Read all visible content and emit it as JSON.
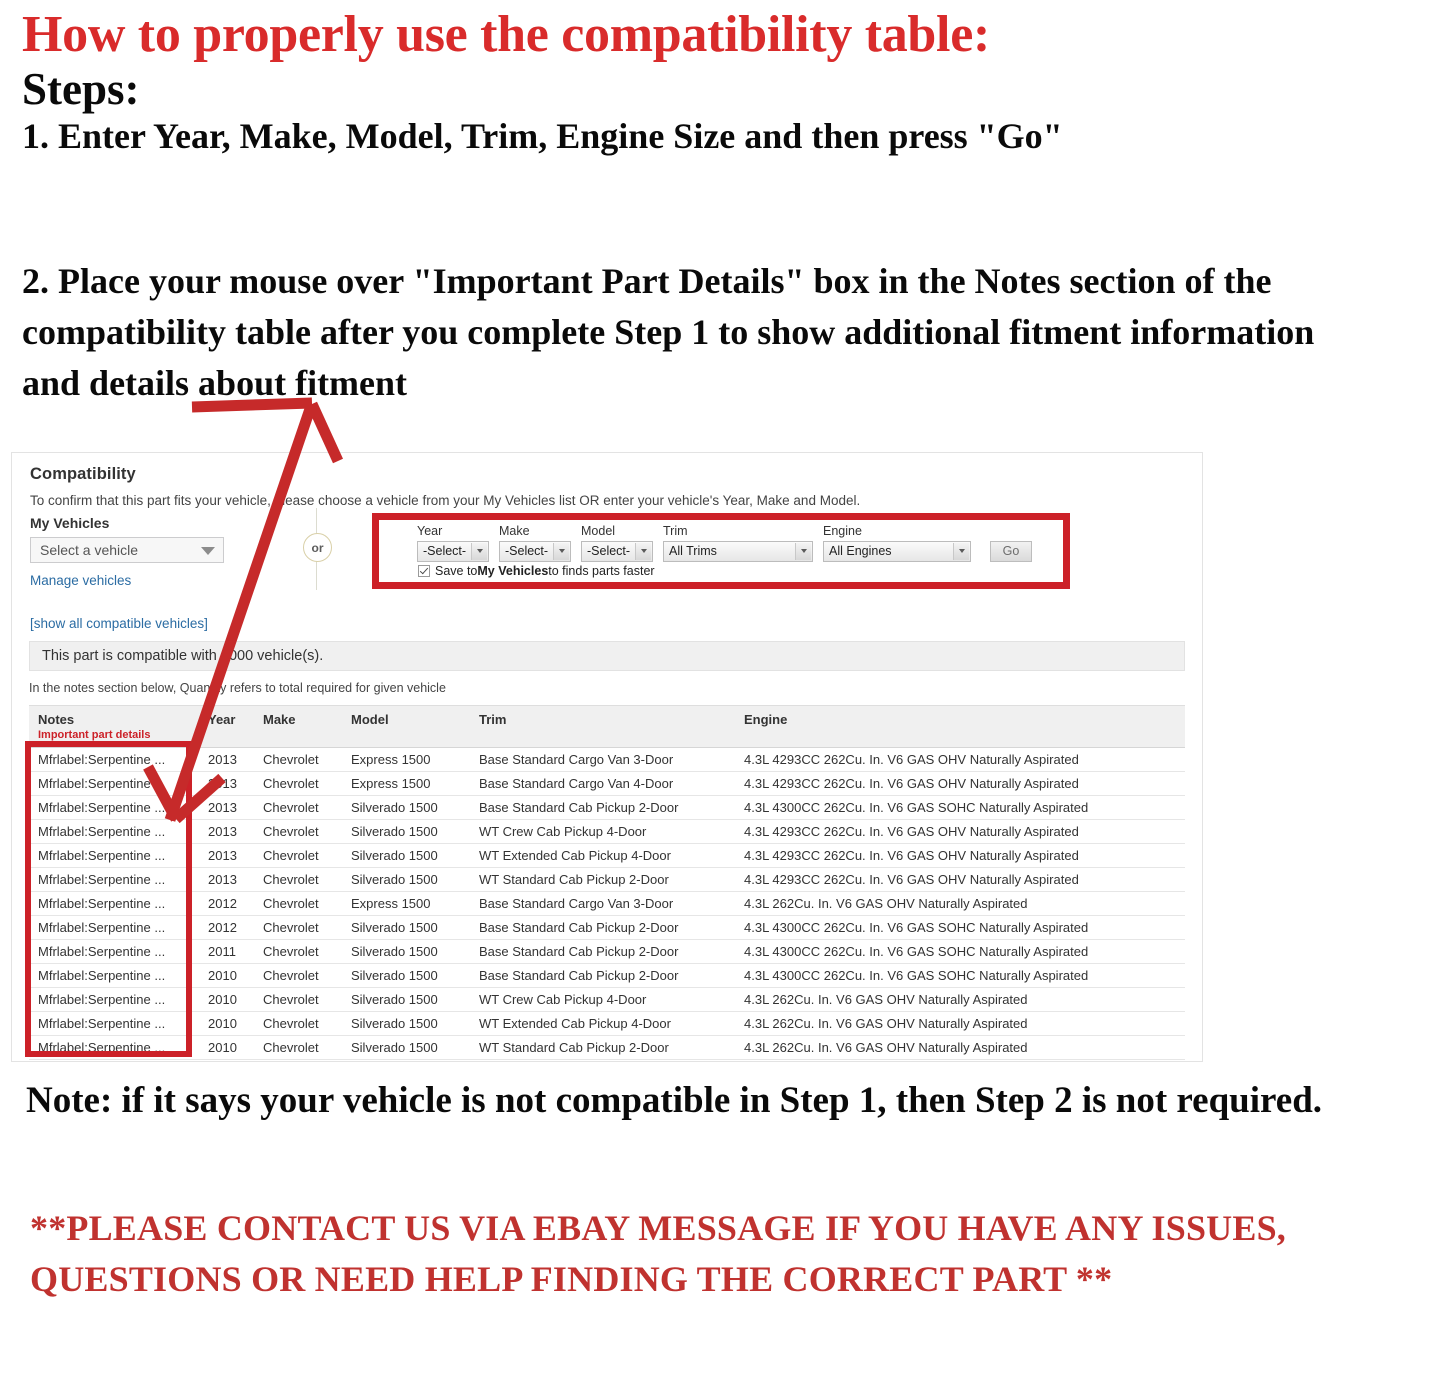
{
  "instructions": {
    "title": "How to properly use the compatibility table:",
    "steps_label": "Steps:",
    "step1": "1. Enter Year, Make, Model, Trim, Engine Size and then press \"Go\"",
    "step2": "2. Place your mouse over \"Important Part Details\" box in the Notes section of the compatibility table after you complete Step 1 to show additional fitment information and details about fitment",
    "bottom_note": "Note: if it says your vehicle is not compatible in Step 1, then Step 2 is not required.",
    "contact_note": "**PLEASE CONTACT US VIA EBAY MESSAGE IF YOU HAVE ANY ISSUES, QUESTIONS OR NEED HELP FINDING THE CORRECT PART **"
  },
  "compatibility": {
    "heading": "Compatibility",
    "description": "To confirm that this part fits your vehicle, please choose a vehicle from your My Vehicles list OR enter your vehicle's Year, Make and Model.",
    "my_vehicles": {
      "label": "My Vehicles",
      "select_value": "Select a vehicle",
      "manage_link": "Manage vehicles",
      "show_all_link": "[show all compatible vehicles]"
    },
    "or_divider": "or",
    "form": {
      "year": {
        "label": "Year",
        "value": "-Select-"
      },
      "make": {
        "label": "Make",
        "value": "-Select-"
      },
      "model": {
        "label": "Model",
        "value": "-Select-"
      },
      "trim": {
        "label": "Trim",
        "value": "All Trims"
      },
      "engine": {
        "label": "Engine",
        "value": "All Engines"
      },
      "go_button": "Go",
      "save_text_before": "Save to ",
      "save_text_bold": "My Vehicles",
      "save_text_after": " to finds parts faster",
      "highlight_color": "#cc2128"
    },
    "result_bar": "This part is compatible with 1000 vehicle(s).",
    "notes_hint": "In the notes section below, Quantity refers to total required for given vehicle",
    "table": {
      "headers": {
        "notes": "Notes",
        "notes_sub": "Important part details",
        "year": "Year",
        "make": "Make",
        "model": "Model",
        "trim": "Trim",
        "engine": "Engine"
      },
      "rows": [
        {
          "notes": "Mfrlabel:Serpentine ...",
          "year": "2013",
          "make": "Chevrolet",
          "model": "Express 1500",
          "trim": "Base Standard Cargo Van 3-Door",
          "engine": "4.3L 4293CC 262Cu. In. V6 GAS OHV Naturally Aspirated"
        },
        {
          "notes": "Mfrlabel:Serpentine ...",
          "year": "2013",
          "make": "Chevrolet",
          "model": "Express 1500",
          "trim": "Base Standard Cargo Van 4-Door",
          "engine": "4.3L 4293CC 262Cu. In. V6 GAS OHV Naturally Aspirated"
        },
        {
          "notes": "Mfrlabel:Serpentine ...",
          "year": "2013",
          "make": "Chevrolet",
          "model": "Silverado 1500",
          "trim": "Base Standard Cab Pickup 2-Door",
          "engine": "4.3L 4300CC 262Cu. In. V6 GAS SOHC Naturally Aspirated"
        },
        {
          "notes": "Mfrlabel:Serpentine ...",
          "year": "2013",
          "make": "Chevrolet",
          "model": "Silverado 1500",
          "trim": "WT Crew Cab Pickup 4-Door",
          "engine": "4.3L 4293CC 262Cu. In. V6 GAS OHV Naturally Aspirated"
        },
        {
          "notes": "Mfrlabel:Serpentine ...",
          "year": "2013",
          "make": "Chevrolet",
          "model": "Silverado 1500",
          "trim": "WT Extended Cab Pickup 4-Door",
          "engine": "4.3L 4293CC 262Cu. In. V6 GAS OHV Naturally Aspirated"
        },
        {
          "notes": "Mfrlabel:Serpentine ...",
          "year": "2013",
          "make": "Chevrolet",
          "model": "Silverado 1500",
          "trim": "WT Standard Cab Pickup 2-Door",
          "engine": "4.3L 4293CC 262Cu. In. V6 GAS OHV Naturally Aspirated"
        },
        {
          "notes": "Mfrlabel:Serpentine ...",
          "year": "2012",
          "make": "Chevrolet",
          "model": "Express 1500",
          "trim": "Base Standard Cargo Van 3-Door",
          "engine": "4.3L 262Cu. In. V6 GAS OHV Naturally Aspirated"
        },
        {
          "notes": "Mfrlabel:Serpentine ...",
          "year": "2012",
          "make": "Chevrolet",
          "model": "Silverado 1500",
          "trim": "Base Standard Cab Pickup 2-Door",
          "engine": "4.3L 4300CC 262Cu. In. V6 GAS SOHC Naturally Aspirated"
        },
        {
          "notes": "Mfrlabel:Serpentine ...",
          "year": "2011",
          "make": "Chevrolet",
          "model": "Silverado 1500",
          "trim": "Base Standard Cab Pickup 2-Door",
          "engine": "4.3L 4300CC 262Cu. In. V6 GAS SOHC Naturally Aspirated"
        },
        {
          "notes": "Mfrlabel:Serpentine ...",
          "year": "2010",
          "make": "Chevrolet",
          "model": "Silverado 1500",
          "trim": "Base Standard Cab Pickup 2-Door",
          "engine": "4.3L 4300CC 262Cu. In. V6 GAS SOHC Naturally Aspirated"
        },
        {
          "notes": "Mfrlabel:Serpentine ...",
          "year": "2010",
          "make": "Chevrolet",
          "model": "Silverado 1500",
          "trim": "WT Crew Cab Pickup 4-Door",
          "engine": "4.3L 262Cu. In. V6 GAS OHV Naturally Aspirated"
        },
        {
          "notes": "Mfrlabel:Serpentine ...",
          "year": "2010",
          "make": "Chevrolet",
          "model": "Silverado 1500",
          "trim": "WT Extended Cab Pickup 4-Door",
          "engine": "4.3L 262Cu. In. V6 GAS OHV Naturally Aspirated"
        },
        {
          "notes": "Mfrlabel:Serpentine ...",
          "year": "2010",
          "make": "Chevrolet",
          "model": "Silverado 1500",
          "trim": "WT Standard Cab Pickup 2-Door",
          "engine": "4.3L 262Cu. In. V6 GAS OHV Naturally Aspirated"
        }
      ]
    }
  }
}
